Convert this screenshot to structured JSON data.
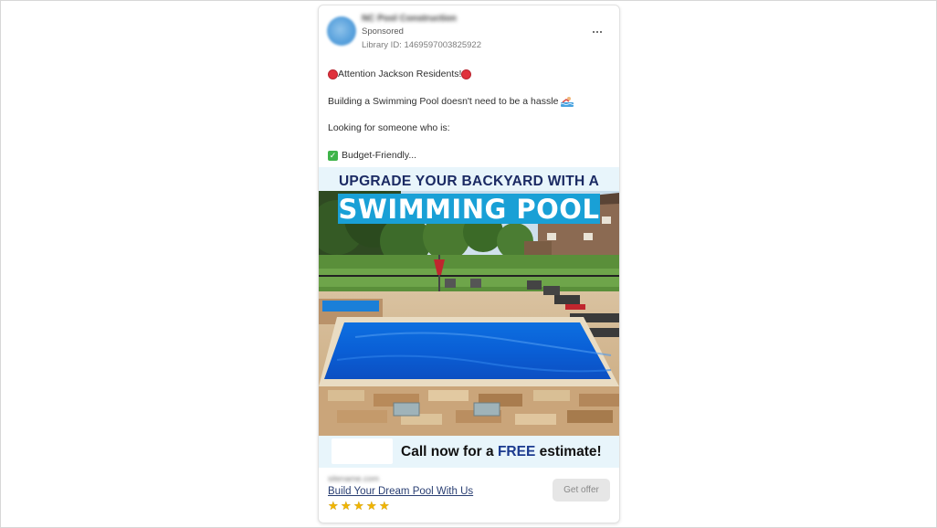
{
  "ad": {
    "page_name": "NC Pool Construction",
    "sponsored_label": "Sponsored",
    "library_id": "Library ID: 1469597003825922",
    "more_icon": "more-options-icon",
    "body": {
      "line1": "Attention Jackson Residents!",
      "line2": "Building a Swimming Pool doesn't need to be a hassle",
      "line3": "Looking for someone who is:",
      "line4": "Budget-Friendly..."
    },
    "creative": {
      "headline_top": "UPGRADE YOUR BACKYARD WITH A",
      "headline_main": "SWIMMING POOL",
      "cta_prefix": "Call now for a ",
      "cta_free": "FREE",
      "cta_suffix": " estimate!"
    },
    "footer": {
      "domain": "sitename.com",
      "title": "Build Your Dream Pool With Us",
      "rating": 5,
      "button_label": "Get offer"
    }
  },
  "colors": {
    "accent_blue": "#19a0d6",
    "navy": "#1b2a63",
    "pale_blue": "#e8f5fb",
    "star": "#f0b400"
  }
}
